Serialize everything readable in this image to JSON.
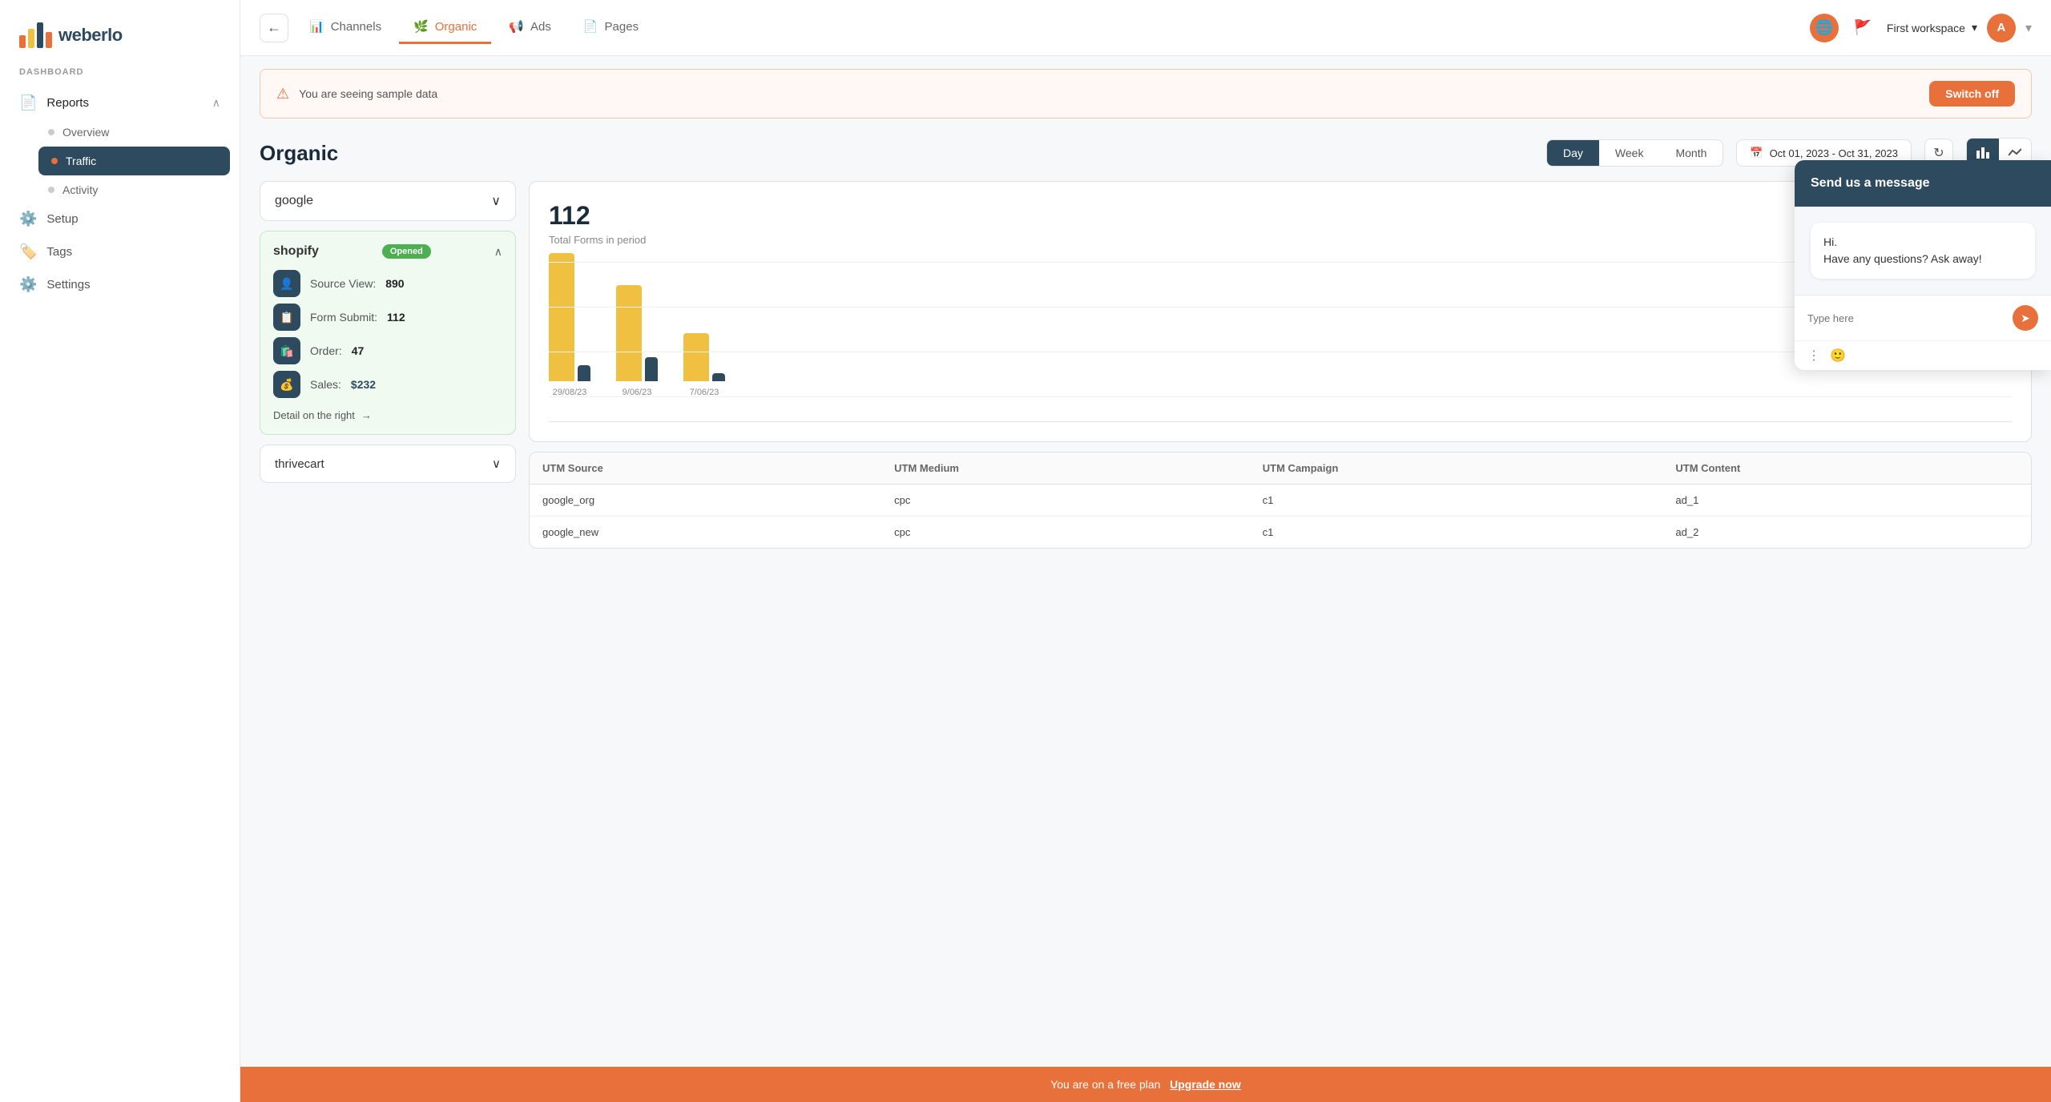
{
  "sidebar": {
    "section_label": "DASHBOARD",
    "items": [
      {
        "id": "reports",
        "label": "Reports",
        "icon": "📄",
        "active": true,
        "has_children": true
      },
      {
        "id": "setup",
        "label": "Setup",
        "icon": "⚙️",
        "active": false
      },
      {
        "id": "tags",
        "label": "Tags",
        "icon": "🏷️",
        "active": false
      },
      {
        "id": "settings",
        "label": "Settings",
        "icon": "⚙️",
        "active": false
      }
    ],
    "sub_items": [
      {
        "id": "overview",
        "label": "Overview",
        "active": false
      },
      {
        "id": "traffic",
        "label": "Traffic",
        "active": true
      },
      {
        "id": "activity",
        "label": "Activity",
        "active": false
      }
    ]
  },
  "topnav": {
    "tabs": [
      {
        "id": "channels",
        "label": "Channels",
        "icon": "📊",
        "active": false
      },
      {
        "id": "organic",
        "label": "Organic",
        "icon": "🌿",
        "active": true
      },
      {
        "id": "ads",
        "label": "Ads",
        "icon": "📢",
        "active": false
      },
      {
        "id": "pages",
        "label": "Pages",
        "icon": "📄",
        "active": false
      }
    ],
    "workspace": "First workspace",
    "avatar_letter": "A"
  },
  "banner": {
    "text": "You are seeing sample data",
    "button": "Switch off"
  },
  "page": {
    "title": "Organic",
    "period_tabs": [
      {
        "id": "day",
        "label": "Day",
        "active": true
      },
      {
        "id": "week",
        "label": "Week",
        "active": false
      },
      {
        "id": "month",
        "label": "Month",
        "active": false
      }
    ],
    "date_range": "Oct 01, 2023 - Oct 31, 2023"
  },
  "sources": {
    "selected": "google",
    "items": [
      "google",
      "thrivecart"
    ]
  },
  "shopify_card": {
    "title": "shopify",
    "badge": "Opened",
    "metrics": [
      {
        "id": "source_view",
        "label": "Source View:",
        "value": "890",
        "icon": "👤"
      },
      {
        "id": "form_submit",
        "label": "Form Submit:",
        "value": "112",
        "icon": "📋"
      },
      {
        "id": "order",
        "label": "Order:",
        "value": "47",
        "icon": "🛍️"
      },
      {
        "id": "sales",
        "label": "Sales:",
        "value": "$232",
        "icon": "💰"
      }
    ],
    "detail_link": "Detail on the right"
  },
  "chart": {
    "metric": "112",
    "label": "Total Forms in period",
    "bars": [
      {
        "date": "29/08/23",
        "yellow_height": 160,
        "dark_height": 20
      },
      {
        "date": "9/06/23",
        "yellow_height": 120,
        "dark_height": 30
      },
      {
        "date": "7/06/23",
        "yellow_height": 60,
        "dark_height": 10
      }
    ]
  },
  "table": {
    "headers": [
      "UTM Source",
      "UTM Medium",
      "UTM Campaign",
      "UTM Content"
    ],
    "rows": [
      {
        "utm_source": "google_org",
        "utm_medium": "cpc",
        "utm_campaign": "c1",
        "utm_content": "ad_1"
      },
      {
        "utm_source": "google_new",
        "utm_medium": "cpc",
        "utm_campaign": "c1",
        "utm_content": "ad_2"
      }
    ]
  },
  "chat": {
    "header": "Send us a message",
    "bubble": "Hi.\nHave any questions? Ask away!",
    "input_placeholder": "Type here"
  },
  "bottom_banner": {
    "text": "You are on a free plan",
    "link": "Upgrade now"
  }
}
